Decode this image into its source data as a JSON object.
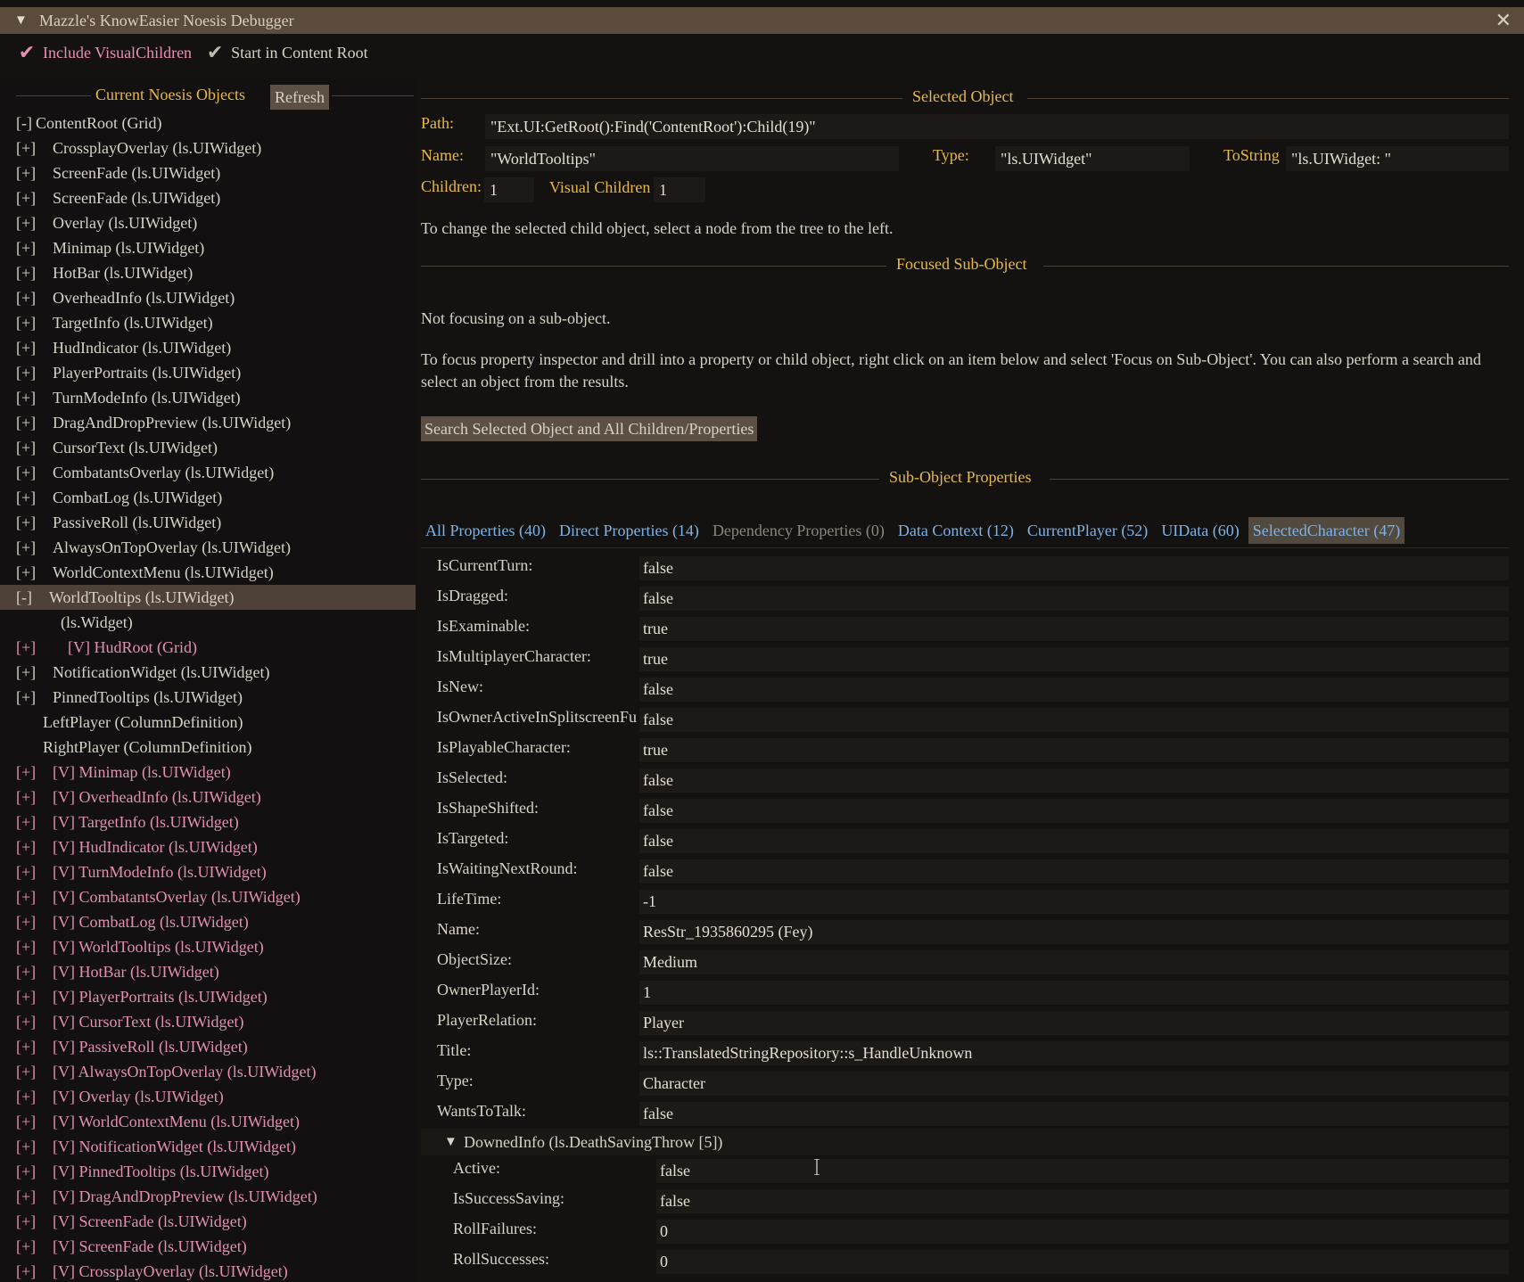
{
  "window": {
    "title": "Mazzle's KnowEasier Noesis Debugger",
    "close_glyph": "✕",
    "collapse_glyph": "▼"
  },
  "options": [
    {
      "label": "Include VisualChildren",
      "checked": true
    },
    {
      "label": "Start in Content Root",
      "checked": true
    }
  ],
  "left_panel": {
    "title": "Current Noesis Objects",
    "refresh_label": "Refresh",
    "tree": [
      {
        "toggle": "[-]",
        "label": "ContentRoot (Grid)",
        "indent": 0,
        "visual": false,
        "selected": false
      },
      {
        "toggle": "[+]",
        "label": "CrossplayOverlay (ls.UIWidget)",
        "indent": 1,
        "visual": false,
        "selected": false
      },
      {
        "toggle": "[+]",
        "label": "ScreenFade (ls.UIWidget)",
        "indent": 1,
        "visual": false,
        "selected": false
      },
      {
        "toggle": "[+]",
        "label": "ScreenFade (ls.UIWidget)",
        "indent": 1,
        "visual": false,
        "selected": false
      },
      {
        "toggle": "[+]",
        "label": "Overlay (ls.UIWidget)",
        "indent": 1,
        "visual": false,
        "selected": false
      },
      {
        "toggle": "[+]",
        "label": "Minimap (ls.UIWidget)",
        "indent": 1,
        "visual": false,
        "selected": false
      },
      {
        "toggle": "[+]",
        "label": "HotBar (ls.UIWidget)",
        "indent": 1,
        "visual": false,
        "selected": false
      },
      {
        "toggle": "[+]",
        "label": "OverheadInfo (ls.UIWidget)",
        "indent": 1,
        "visual": false,
        "selected": false
      },
      {
        "toggle": "[+]",
        "label": "TargetInfo (ls.UIWidget)",
        "indent": 1,
        "visual": false,
        "selected": false
      },
      {
        "toggle": "[+]",
        "label": "HudIndicator (ls.UIWidget)",
        "indent": 1,
        "visual": false,
        "selected": false
      },
      {
        "toggle": "[+]",
        "label": "PlayerPortraits (ls.UIWidget)",
        "indent": 1,
        "visual": false,
        "selected": false
      },
      {
        "toggle": "[+]",
        "label": "TurnModeInfo (ls.UIWidget)",
        "indent": 1,
        "visual": false,
        "selected": false
      },
      {
        "toggle": "[+]",
        "label": "DragAndDropPreview (ls.UIWidget)",
        "indent": 1,
        "visual": false,
        "selected": false
      },
      {
        "toggle": "[+]",
        "label": "CursorText (ls.UIWidget)",
        "indent": 1,
        "visual": false,
        "selected": false
      },
      {
        "toggle": "[+]",
        "label": "CombatantsOverlay (ls.UIWidget)",
        "indent": 1,
        "visual": false,
        "selected": false
      },
      {
        "toggle": "[+]",
        "label": "CombatLog (ls.UIWidget)",
        "indent": 1,
        "visual": false,
        "selected": false
      },
      {
        "toggle": "[+]",
        "label": "PassiveRoll (ls.UIWidget)",
        "indent": 1,
        "visual": false,
        "selected": false
      },
      {
        "toggle": "[+]",
        "label": "AlwaysOnTopOverlay (ls.UIWidget)",
        "indent": 1,
        "visual": false,
        "selected": false
      },
      {
        "toggle": "[+]",
        "label": "WorldContextMenu (ls.UIWidget)",
        "indent": 1,
        "visual": false,
        "selected": false
      },
      {
        "toggle": "[-]",
        "label": "WorldTooltips (ls.UIWidget)",
        "indent": 1,
        "visual": false,
        "selected": true
      },
      {
        "toggle": "",
        "label": "(ls.Widget)",
        "indent": 2,
        "visual": false,
        "selected": false
      },
      {
        "toggle": "[+]",
        "label": "[V] HudRoot (Grid)",
        "indent": 3,
        "visual": true,
        "selected": false
      },
      {
        "toggle": "[+]",
        "label": "NotificationWidget (ls.UIWidget)",
        "indent": 1,
        "visual": false,
        "selected": false
      },
      {
        "toggle": "[+]",
        "label": "PinnedTooltips (ls.UIWidget)",
        "indent": 1,
        "visual": false,
        "selected": false
      },
      {
        "toggle": "",
        "label": "LeftPlayer (ColumnDefinition)",
        "indent": 4,
        "visual": false,
        "selected": false
      },
      {
        "toggle": "",
        "label": "RightPlayer (ColumnDefinition)",
        "indent": 4,
        "visual": false,
        "selected": false
      },
      {
        "toggle": "[+]",
        "label": "[V] Minimap (ls.UIWidget)",
        "indent": 1,
        "visual": true,
        "selected": false
      },
      {
        "toggle": "[+]",
        "label": "[V] OverheadInfo (ls.UIWidget)",
        "indent": 1,
        "visual": true,
        "selected": false
      },
      {
        "toggle": "[+]",
        "label": "[V] TargetInfo (ls.UIWidget)",
        "indent": 1,
        "visual": true,
        "selected": false
      },
      {
        "toggle": "[+]",
        "label": "[V] HudIndicator (ls.UIWidget)",
        "indent": 1,
        "visual": true,
        "selected": false
      },
      {
        "toggle": "[+]",
        "label": "[V] TurnModeInfo (ls.UIWidget)",
        "indent": 1,
        "visual": true,
        "selected": false
      },
      {
        "toggle": "[+]",
        "label": "[V] CombatantsOverlay (ls.UIWidget)",
        "indent": 1,
        "visual": true,
        "selected": false
      },
      {
        "toggle": "[+]",
        "label": "[V] CombatLog (ls.UIWidget)",
        "indent": 1,
        "visual": true,
        "selected": false
      },
      {
        "toggle": "[+]",
        "label": "[V] WorldTooltips (ls.UIWidget)",
        "indent": 1,
        "visual": true,
        "selected": false
      },
      {
        "toggle": "[+]",
        "label": "[V] HotBar (ls.UIWidget)",
        "indent": 1,
        "visual": true,
        "selected": false
      },
      {
        "toggle": "[+]",
        "label": "[V] PlayerPortraits (ls.UIWidget)",
        "indent": 1,
        "visual": true,
        "selected": false
      },
      {
        "toggle": "[+]",
        "label": "[V] CursorText (ls.UIWidget)",
        "indent": 1,
        "visual": true,
        "selected": false
      },
      {
        "toggle": "[+]",
        "label": "[V] PassiveRoll (ls.UIWidget)",
        "indent": 1,
        "visual": true,
        "selected": false
      },
      {
        "toggle": "[+]",
        "label": "[V] AlwaysOnTopOverlay (ls.UIWidget)",
        "indent": 1,
        "visual": true,
        "selected": false
      },
      {
        "toggle": "[+]",
        "label": "[V] Overlay (ls.UIWidget)",
        "indent": 1,
        "visual": true,
        "selected": false
      },
      {
        "toggle": "[+]",
        "label": "[V] WorldContextMenu (ls.UIWidget)",
        "indent": 1,
        "visual": true,
        "selected": false
      },
      {
        "toggle": "[+]",
        "label": "[V] NotificationWidget (ls.UIWidget)",
        "indent": 1,
        "visual": true,
        "selected": false
      },
      {
        "toggle": "[+]",
        "label": "[V] PinnedTooltips (ls.UIWidget)",
        "indent": 1,
        "visual": true,
        "selected": false
      },
      {
        "toggle": "[+]",
        "label": "[V] DragAndDropPreview (ls.UIWidget)",
        "indent": 1,
        "visual": true,
        "selected": false
      },
      {
        "toggle": "[+]",
        "label": "[V] ScreenFade (ls.UIWidget)",
        "indent": 1,
        "visual": true,
        "selected": false
      },
      {
        "toggle": "[+]",
        "label": "[V] ScreenFade (ls.UIWidget)",
        "indent": 1,
        "visual": true,
        "selected": false
      },
      {
        "toggle": "[+]",
        "label": "[V] CrossplayOverlay (ls.UIWidget)",
        "indent": 1,
        "visual": true,
        "selected": false
      }
    ]
  },
  "selected_object": {
    "title": "Selected Object",
    "path_label": "Path:",
    "path_value": "\"Ext.UI:GetRoot():Find('ContentRoot'):Child(19)\"",
    "name_label": "Name:",
    "name_value": "\"WorldTooltips\"",
    "type_label": "Type:",
    "type_value": "\"ls.UIWidget\"",
    "tostring_label": "ToString",
    "tostring_value": "\"ls.UIWidget: \"",
    "children_label": "Children:",
    "children_value": "1",
    "visual_children_label": "Visual Children",
    "visual_children_value": "1",
    "hint": "To change the selected child object, select a node from the tree to the left."
  },
  "focused": {
    "title": "Focused Sub-Object",
    "status": "Not focusing on a sub-object.",
    "help": "To focus property inspector and drill into a property or child object, right click on an item below and select 'Focus on Sub-Object'. You can also perform a search and select an object from the results.",
    "search_button": "Search Selected Object and All Children/Properties"
  },
  "subprops": {
    "title": "Sub-Object Properties",
    "tabs": [
      {
        "label": "All Properties (40)",
        "state": "normal"
      },
      {
        "label": "Direct Properties (14)",
        "state": "normal"
      },
      {
        "label": "Dependency Properties (0)",
        "state": "disabled"
      },
      {
        "label": "Data Context (12)",
        "state": "normal"
      },
      {
        "label": "CurrentPlayer (52)",
        "state": "normal"
      },
      {
        "label": "UIData (60)",
        "state": "normal"
      },
      {
        "label": "SelectedCharacter (47)",
        "state": "active"
      }
    ],
    "rows": [
      {
        "key": "IsCurrentTurn:",
        "value": "false"
      },
      {
        "key": "IsDragged:",
        "value": "false"
      },
      {
        "key": "IsExaminable:",
        "value": "true"
      },
      {
        "key": "IsMultiplayerCharacter:",
        "value": "true"
      },
      {
        "key": "IsNew:",
        "value": "false"
      },
      {
        "key": "IsOwnerActiveInSplitscreenFu",
        "value": "false"
      },
      {
        "key": "IsPlayableCharacter:",
        "value": "true"
      },
      {
        "key": "IsSelected:",
        "value": "false"
      },
      {
        "key": "IsShapeShifted:",
        "value": "false"
      },
      {
        "key": "IsTargeted:",
        "value": "false"
      },
      {
        "key": "IsWaitingNextRound:",
        "value": "false"
      },
      {
        "key": "LifeTime:",
        "value": "-1"
      },
      {
        "key": "Name:",
        "value": "ResStr_1935860295 (Fey)"
      },
      {
        "key": "ObjectSize:",
        "value": "Medium"
      },
      {
        "key": "OwnerPlayerId:",
        "value": "1"
      },
      {
        "key": "PlayerRelation:",
        "value": "Player"
      },
      {
        "key": "Title:",
        "value": "ls::TranslatedStringRepository::s_HandleUnknown"
      },
      {
        "key": "Type:",
        "value": "Character"
      },
      {
        "key": "WantsToTalk:",
        "value": "false"
      }
    ],
    "group": {
      "arrow": "▼",
      "label": "DownedInfo (ls.DeathSavingThrow [5])",
      "rows": [
        {
          "key": "Active:",
          "value": "false"
        },
        {
          "key": "IsSuccessSaving:",
          "value": "false"
        },
        {
          "key": "RollFailures:",
          "value": "0"
        },
        {
          "key": "RollSuccesses:",
          "value": "0"
        }
      ]
    }
  },
  "colors": {
    "accent_gold": "#e6b94a",
    "link_blue": "#7eb2e4",
    "visual_pink": "#e58fb3",
    "selected_bg": "#4e4238",
    "titlebar_bg": "#5a4b3d"
  }
}
